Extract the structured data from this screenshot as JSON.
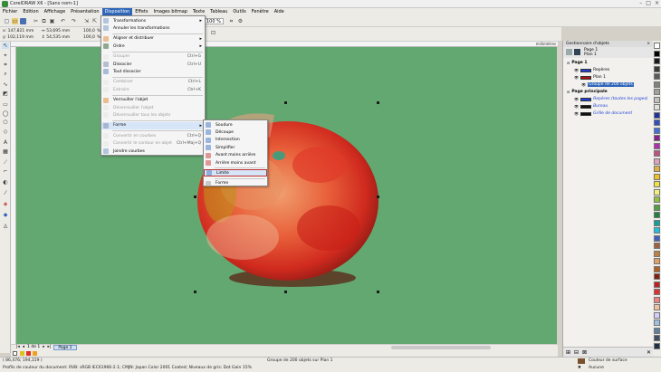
{
  "app": {
    "title": "CorelDRAW X6 - [Sans nom-1]",
    "window_controls": [
      "–",
      "□",
      "×"
    ]
  },
  "menubar": [
    "Fichier",
    "Edition",
    "Affichage",
    "Présentation",
    "Disposition",
    "Effets",
    "Images bitmap",
    "Texte",
    "Tableau",
    "Outils",
    "Fenêtre",
    "Aide"
  ],
  "menubar_active": "Disposition",
  "toolbar": {
    "zoom_label": "100 %"
  },
  "propbar": {
    "x": "x: 147,821 mm",
    "y": "y: 102,119 mm",
    "w": "↔ 53,695 mm",
    "h": "↕ 54,535 mm",
    "scale_w": "100,0",
    "scale_h": "100,0",
    "percent": "%"
  },
  "ruler_label": "millimètres",
  "disposition_menu": [
    {
      "label": "Transformations",
      "shortcut": "",
      "submenu": true,
      "disabled": false
    },
    {
      "label": "Annuler les transformations",
      "shortcut": "",
      "submenu": false,
      "disabled": false
    },
    {
      "sep": true
    },
    {
      "label": "Aligner et distribuer",
      "shortcut": "",
      "submenu": true,
      "disabled": false
    },
    {
      "label": "Ordre",
      "shortcut": "",
      "submenu": true,
      "disabled": false
    },
    {
      "sep": true
    },
    {
      "label": "Grouper",
      "shortcut": "Ctrl+G",
      "submenu": false,
      "disabled": true
    },
    {
      "label": "Dissocier",
      "shortcut": "Ctrl+U",
      "submenu": false,
      "disabled": false
    },
    {
      "label": "Tout dissocier",
      "shortcut": "",
      "submenu": false,
      "disabled": false
    },
    {
      "sep": true
    },
    {
      "label": "Combiner",
      "shortcut": "Ctrl+L",
      "submenu": false,
      "disabled": true
    },
    {
      "label": "Extraire",
      "shortcut": "Ctrl+K",
      "submenu": false,
      "disabled": true
    },
    {
      "sep": true
    },
    {
      "label": "Verrouiller l'objet",
      "shortcut": "",
      "submenu": false,
      "disabled": false
    },
    {
      "label": "Déverrouiller l'objet",
      "shortcut": "",
      "submenu": false,
      "disabled": true
    },
    {
      "label": "Déverrouiller tous les objets",
      "shortcut": "",
      "submenu": false,
      "disabled": true
    },
    {
      "sep": true
    },
    {
      "label": "Forme",
      "shortcut": "",
      "submenu": true,
      "disabled": false,
      "highlight": true
    },
    {
      "sep": true
    },
    {
      "label": "Convertir en courbes",
      "shortcut": "Ctrl+Q",
      "submenu": false,
      "disabled": true
    },
    {
      "label": "Convertir le contour en objet",
      "shortcut": "Ctrl+Maj+Q",
      "submenu": false,
      "disabled": true
    },
    {
      "label": "Joindre courbes",
      "shortcut": "",
      "submenu": false,
      "disabled": false
    }
  ],
  "forme_submenu": [
    {
      "label": "Soudure"
    },
    {
      "label": "Découpe"
    },
    {
      "label": "Intersection"
    },
    {
      "label": "Simplifier"
    },
    {
      "label": "Avant moins arrière"
    },
    {
      "label": "Arrière moins avant"
    },
    {
      "sep": true
    },
    {
      "label": "Limite",
      "highlight": true
    },
    {
      "sep": true
    },
    {
      "label": "Forme"
    }
  ],
  "docker": {
    "title": "Gestionnaire d'objets",
    "page_label": "Page 1",
    "layer_label": "Plan 1",
    "tree": [
      {
        "label": "Page 1",
        "level": 0,
        "bold": true
      },
      {
        "label": "Repères",
        "level": 1,
        "color": "#1f3fd6"
      },
      {
        "label": "Plan 1",
        "level": 1,
        "color": "#b01010"
      },
      {
        "label": "Groupe de 200 objets",
        "level": 2,
        "selected": true
      },
      {
        "label": "Page principale",
        "level": 0,
        "bold": true
      },
      {
        "label": "Repères (toutes les pages)",
        "level": 1,
        "color": "#1f3fd6"
      },
      {
        "label": "Bureau",
        "level": 1,
        "color": "#111"
      },
      {
        "label": "Grille de document",
        "level": 1,
        "color": "#111"
      }
    ]
  },
  "pagenav": {
    "counter": "1 de 1",
    "tab": "Page 1"
  },
  "status": {
    "coords": "( 86,476; 194,159 )",
    "selection": "Groupe de 200 objets sur Plan 1",
    "profile": "Profils de couleur du document: RVB: sRGB IEC61966-2.1; CMJN: Japan Color 2001 Coated; Niveaux de gris: Dot Gain 15%",
    "fill": "Couleur de surface",
    "outline": "Aucune"
  },
  "colors": {
    "canvas": "#63a871",
    "selection": "#2f66b8"
  }
}
